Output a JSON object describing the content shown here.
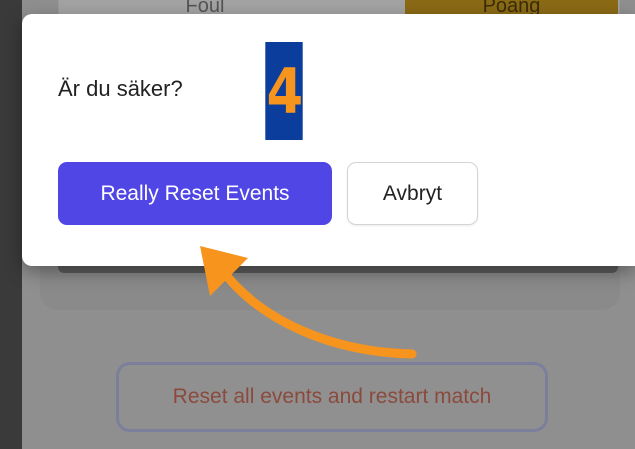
{
  "background": {
    "top_row": {
      "left_label": "Foul",
      "right_label": "Poäng"
    },
    "reset_button_label": "Reset all events and restart match"
  },
  "dialog": {
    "message": "Är du säker?",
    "confirm_label": "Really Reset Events",
    "cancel_label": "Avbryt"
  },
  "annotation": {
    "step_number": "4",
    "arrow_color": "#f7941d",
    "badge_color": "#0a3d9c"
  },
  "colors": {
    "primary": "#4f46e5",
    "overlay": "#8f8f8f"
  }
}
